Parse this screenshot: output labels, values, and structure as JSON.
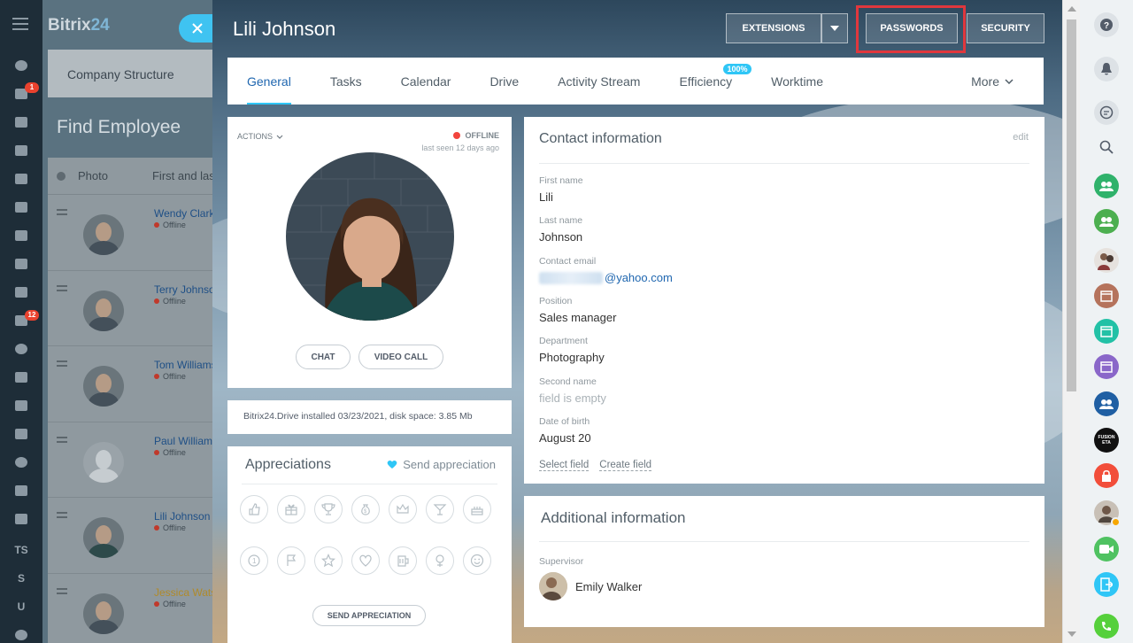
{
  "app": {
    "logo_main": "Bitrix",
    "logo_num": "24"
  },
  "leftbar": {
    "badges": [
      "1",
      "12"
    ],
    "letters": [
      "TS",
      "S",
      "U"
    ]
  },
  "background_page": {
    "section": "Company Structure",
    "title": "Find Employee",
    "columns": [
      "Photo",
      "First and las"
    ],
    "employees": [
      {
        "name": "Wendy Clark",
        "status": "Offline"
      },
      {
        "name": "Terry Johnson",
        "status": "Offline"
      },
      {
        "name": "Tom Williams",
        "status": "Offline"
      },
      {
        "name": "Paul Williams",
        "status": "Offline"
      },
      {
        "name": "Lili Johnson",
        "status": "Offline"
      },
      {
        "name": "Jessica Watson",
        "status": "Offline"
      }
    ]
  },
  "slider": {
    "title": "Lili Johnson",
    "buttons": {
      "extensions": "EXTENSIONS",
      "passwords": "PASSWORDS",
      "security": "SECURITY"
    },
    "tabs": [
      {
        "label": "General",
        "active": true
      },
      {
        "label": "Tasks"
      },
      {
        "label": "Calendar"
      },
      {
        "label": "Drive"
      },
      {
        "label": "Activity Stream"
      },
      {
        "label": "Efficiency",
        "badge": "100%"
      },
      {
        "label": "Worktime"
      }
    ],
    "more_label": "More"
  },
  "profile": {
    "actions": "ACTIONS",
    "status": "OFFLINE",
    "last_seen": "last seen 12 days ago",
    "chat": "CHAT",
    "video_call": "VIDEO CALL"
  },
  "drive": {
    "text": "Bitrix24.Drive installed 03/23/2021, disk space: 3.85 Mb"
  },
  "appreciations": {
    "title": "Appreciations",
    "send_link": "Send appreciation",
    "send_button": "SEND APPRECIATION",
    "icons": [
      "thumb-up-icon",
      "gift-icon",
      "trophy-icon",
      "money-bag-icon",
      "crown-icon",
      "cocktail-icon",
      "cake-icon",
      "number-one-icon",
      "flag-icon",
      "star-icon",
      "heart-icon",
      "beer-icon",
      "flower-icon",
      "smile-icon"
    ]
  },
  "contact": {
    "title": "Contact information",
    "edit": "edit",
    "fields": {
      "first_name": {
        "label": "First name",
        "value": "Lili"
      },
      "last_name": {
        "label": "Last name",
        "value": "Johnson"
      },
      "email": {
        "label": "Contact email",
        "value": "@yahoo.com"
      },
      "position": {
        "label": "Position",
        "value": "Sales manager"
      },
      "department": {
        "label": "Department",
        "value": "Photography"
      },
      "second_name": {
        "label": "Second name",
        "value": "field is empty"
      },
      "dob": {
        "label": "Date of birth",
        "value": "August 20"
      }
    },
    "select_field": "Select field",
    "create_field": "Create field"
  },
  "additional": {
    "title": "Additional information",
    "supervisor_label": "Supervisor",
    "supervisor_name": "Emily Walker"
  },
  "rightbar": {
    "label_fusion": "FUSION ETA"
  },
  "colors": {
    "accent": "#2fc6f6",
    "link": "#2067b0",
    "highlight": "#e0373d",
    "offline": "#f2453d"
  }
}
